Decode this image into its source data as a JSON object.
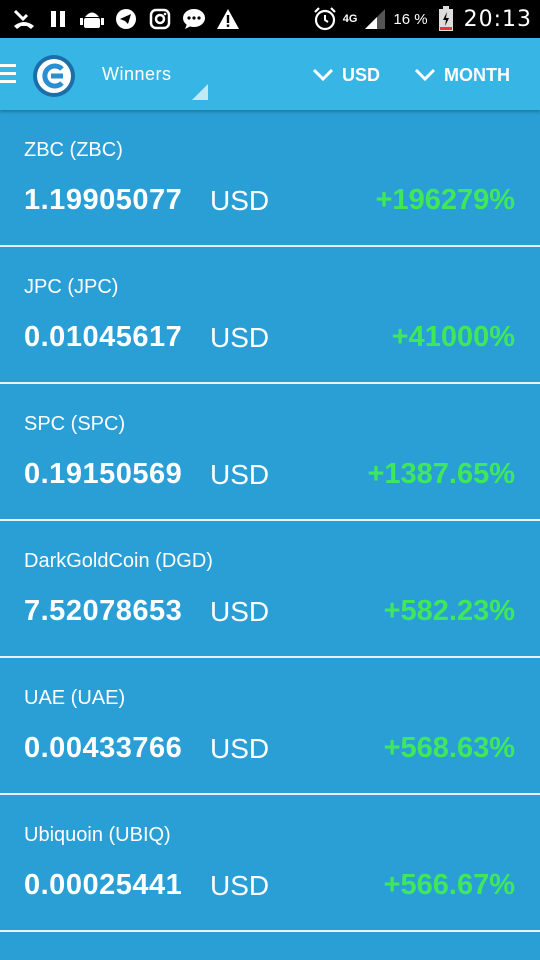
{
  "status_bar": {
    "network": "4G",
    "battery_percent": "16 %",
    "time": "20:13",
    "left_icons": [
      "missed-call-icon",
      "pause-icon",
      "android-debug-icon",
      "telegram-icon",
      "instagram-icon",
      "messenger-icon",
      "warning-icon"
    ],
    "right_icons": [
      "alarm-icon",
      "signal-icon",
      "battery-icon"
    ]
  },
  "app_bar": {
    "filter_label": "Winners",
    "currency_label": "USD",
    "period_label": "MONTH"
  },
  "coins": [
    {
      "name": "ZBC (ZBC)",
      "price": "1.19905077",
      "currency": "USD",
      "change": "+196279%"
    },
    {
      "name": "JPC (JPC)",
      "price": "0.01045617",
      "currency": "USD",
      "change": "+41000%"
    },
    {
      "name": "SPC (SPC)",
      "price": "0.19150569",
      "currency": "USD",
      "change": "+1387.65%"
    },
    {
      "name": "DarkGoldCoin (DGD)",
      "price": "7.52078653",
      "currency": "USD",
      "change": "+582.23%"
    },
    {
      "name": "UAE (UAE)",
      "price": "0.00433766",
      "currency": "USD",
      "change": "+568.63%"
    },
    {
      "name": "Ubiquoin (UBIQ)",
      "price": "0.00025441",
      "currency": "USD",
      "change": "+566.67%"
    }
  ],
  "colors": {
    "background": "#2a9fd6",
    "app_bar": "#37b5e5",
    "positive_change": "#3ee85a",
    "divider": "#e6f3fa"
  }
}
